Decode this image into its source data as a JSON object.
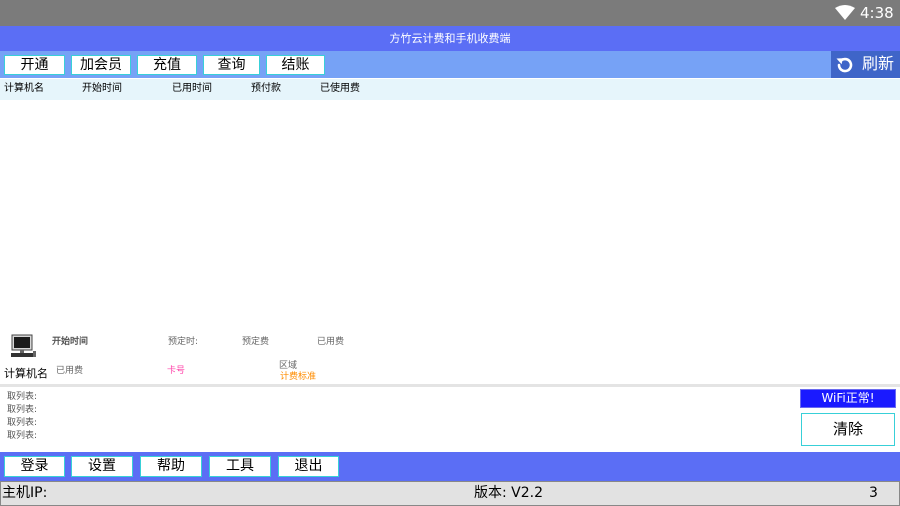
{
  "status_bar": {
    "time": "4:38"
  },
  "title": "方竹云计费和手机收费端",
  "toolbar": {
    "buttons": [
      "开通",
      "加会员",
      "充值",
      "查询",
      "结账"
    ],
    "refresh_label": "刷新"
  },
  "table": {
    "columns": [
      "计算机名",
      "开始时间",
      "已用时间",
      "预付款",
      "已使用费"
    ],
    "rows": []
  },
  "details": {
    "start_time_label": "开始时间",
    "reserve_time_label": "预定时:",
    "reserve_fee_label": "预定费",
    "used_fee_label": "已用费",
    "computer_name_label": "计算机名",
    "used_time_label": "已用费",
    "card_label": "卡号",
    "area_label": "区域",
    "billing_label": "计费标准"
  },
  "logs": [
    "取列表:",
    "取列表:",
    "取列表:",
    "取列表:"
  ],
  "wifi_status": "WiFi正常!",
  "clear_label": "清除",
  "bottom_toolbar": {
    "buttons": [
      "登录",
      "设置",
      "帮助",
      "工具",
      "退出"
    ]
  },
  "footer": {
    "host_ip_label": "主机IP:",
    "version": "版本: V2.2",
    "count": "3"
  },
  "colors": {
    "title_bar": "#5b6ef5",
    "toolbar": "#76a2f6",
    "refresh": "#3f65c8",
    "button_border": "#38d0d8",
    "wifi_box": "#1a1aff",
    "card_label": "#ff44aa",
    "billing_label": "#ff8c00"
  }
}
